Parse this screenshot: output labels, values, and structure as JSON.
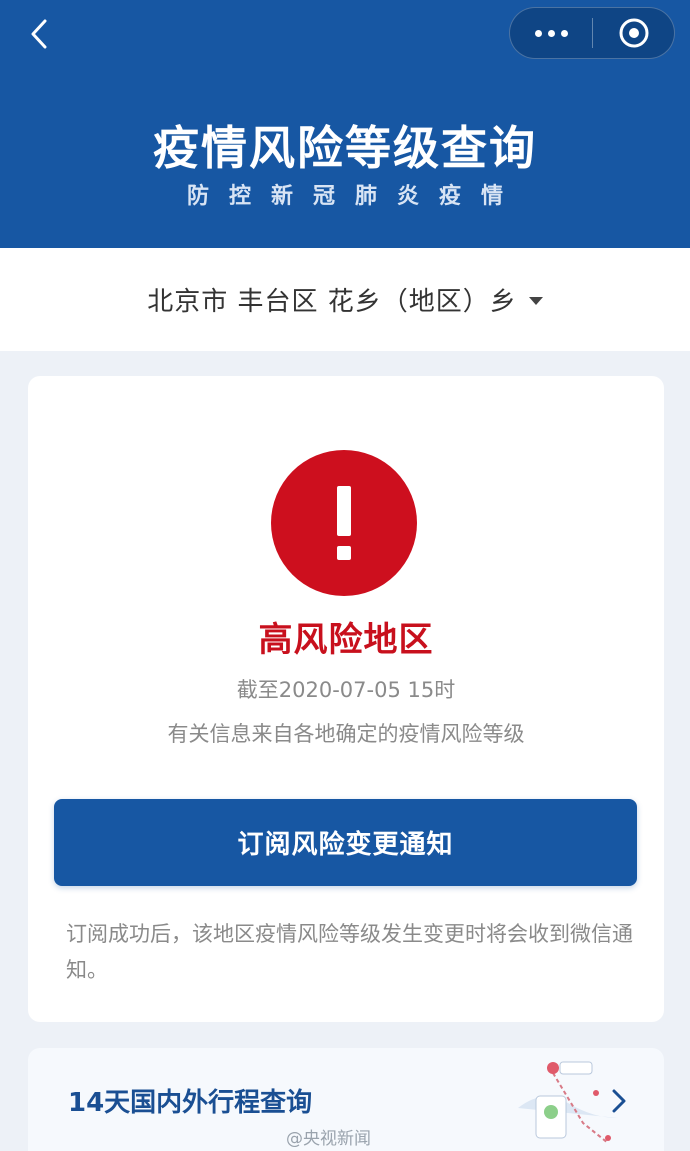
{
  "header": {
    "title": "疫情风险等级查询",
    "subtitle": "防控新冠肺炎疫情"
  },
  "location": {
    "selected": "北京市 丰台区 花乡（地区）乡"
  },
  "status": {
    "risk_level": "高风险地区",
    "as_of": "截至2020-07-05 15时",
    "source_note": "有关信息来自各地确定的疫情风险等级"
  },
  "subscribe": {
    "button_label": "订阅风险变更通知",
    "description": "订阅成功后，该地区疫情风险等级发生变更时将会收到微信通知。"
  },
  "trip": {
    "label": "14天国内外行程查询"
  },
  "watermark": {
    "text": "@央视新闻"
  },
  "colors": {
    "brand_blue": "#1757a3",
    "risk_red": "#cd0f1e"
  },
  "icons": {
    "back": "back-arrow-icon",
    "more": "more-dots-icon",
    "close": "close-circle-icon",
    "dropdown": "caret-down-icon",
    "risk": "exclamation-icon",
    "chevron": "chevron-right-icon"
  }
}
